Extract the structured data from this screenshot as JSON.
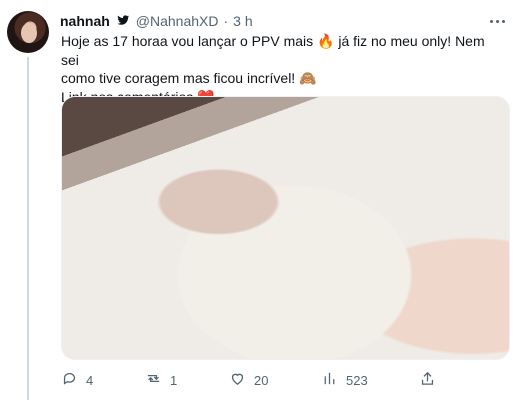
{
  "tweet": {
    "display_name": "nahnah",
    "verified_icon": "twitter-bird-icon",
    "handle": "@NahnahXD",
    "separator": "·",
    "timestamp": "3 h",
    "text": "Hoje as 17 horaa vou lançar o PPV mais 🔥 já fiz no meu only! Nem sei\ncomo tive coragem mas ficou incrível! 🙈\nLink nos comentários ❤️",
    "actions": {
      "reply_count": "4",
      "retweet_count": "1",
      "like_count": "20",
      "views_count": "523"
    }
  }
}
